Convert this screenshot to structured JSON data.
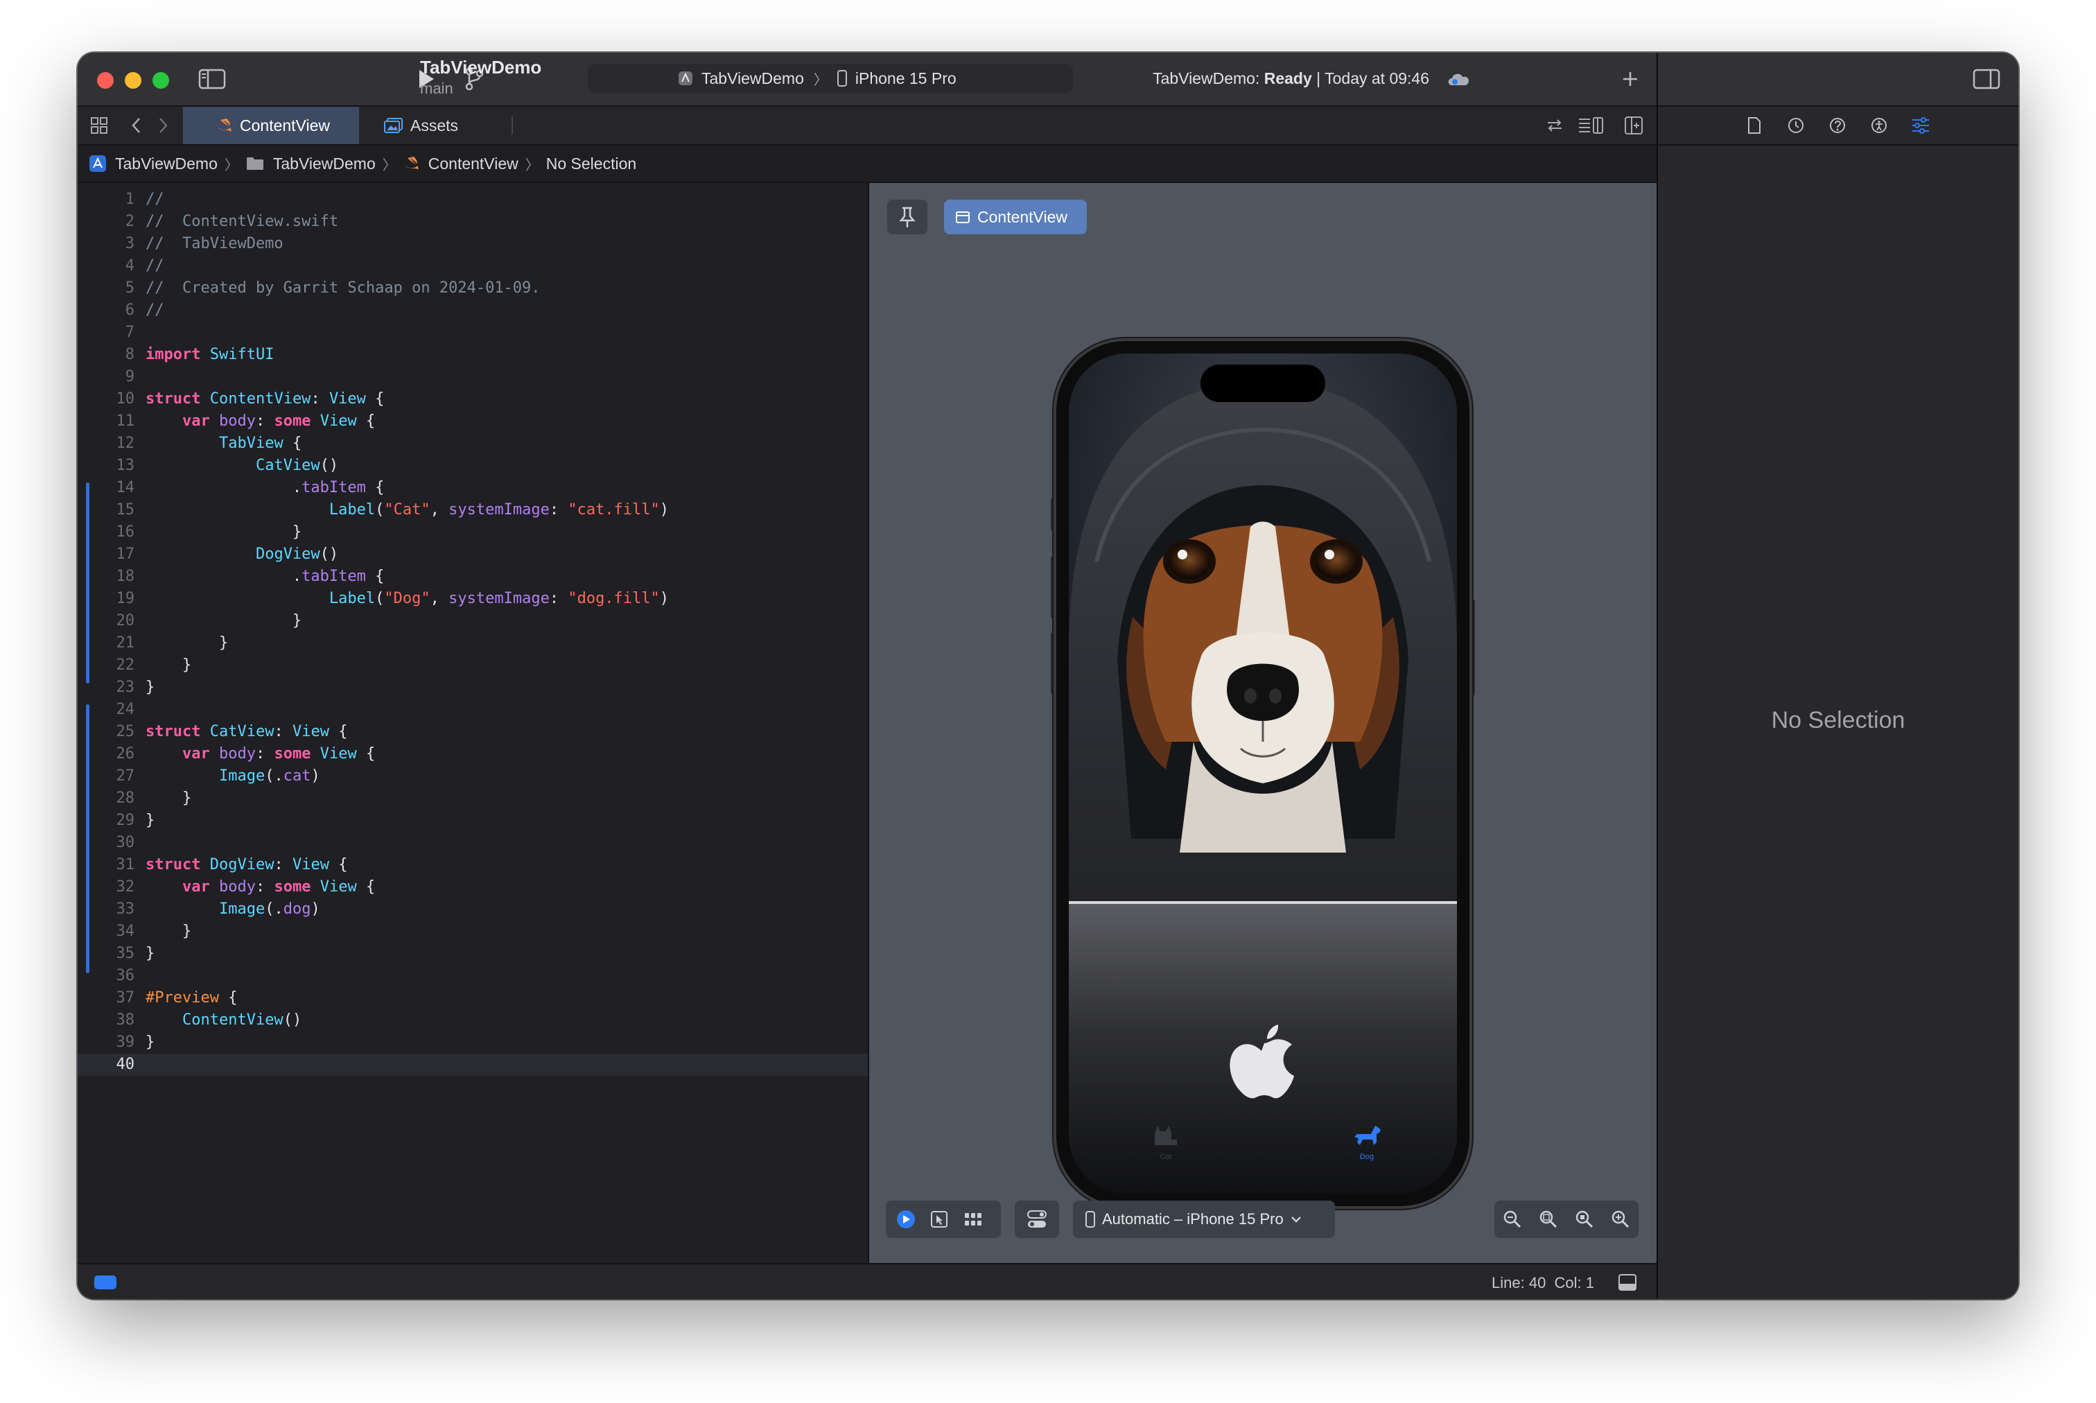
{
  "window": {
    "project_name": "TabViewDemo",
    "branch": "main",
    "scheme": "TabViewDemo",
    "destination": "iPhone 15 Pro",
    "status_prefix": "TabViewDemo: ",
    "status_state": "Ready",
    "status_time": " | Today at 09:46"
  },
  "tabs": [
    {
      "label": "ContentView",
      "active": true
    },
    {
      "label": "Assets",
      "active": false
    }
  ],
  "breadcrumb": [
    "TabViewDemo",
    "TabViewDemo",
    "ContentView",
    "No Selection"
  ],
  "editor": {
    "current_line": 40,
    "lines": [
      "//",
      "//  ContentView.swift",
      "//  TabViewDemo",
      "//",
      "//  Created by Garrit Schaap on 2024-01-09.",
      "//",
      "",
      "import SwiftUI",
      "",
      "struct ContentView: View {",
      "    var body: some View {",
      "        TabView {",
      "            CatView()",
      "                .tabItem {",
      "                    Label(\"Cat\", systemImage: \"cat.fill\")",
      "                }",
      "            DogView()",
      "                .tabItem {",
      "                    Label(\"Dog\", systemImage: \"dog.fill\")",
      "                }",
      "        }",
      "    }",
      "}",
      "",
      "struct CatView: View {",
      "    var body: some View {",
      "        Image(.cat)",
      "    }",
      "}",
      "",
      "struct DogView: View {",
      "    var body: some View {",
      "        Image(.dog)",
      "    }",
      "}",
      "",
      "#Preview {",
      "    ContentView()",
      "}",
      ""
    ]
  },
  "canvas": {
    "preview_name": "ContentView",
    "device_menu": "Automatic – iPhone 15 Pro",
    "tabbar_items": [
      {
        "label": "Cat",
        "icon": "cat-icon",
        "selected": false
      },
      {
        "label": "Dog",
        "icon": "dog-icon",
        "selected": true
      }
    ]
  },
  "statusbar": {
    "cursor": "Line: 40  Col: 1"
  },
  "inspector": {
    "empty_text": "No Selection"
  },
  "colors": {
    "accent": "#2f6fd8",
    "active_tab": "#3e4a62",
    "tab_selected": "#2f7bf5"
  }
}
